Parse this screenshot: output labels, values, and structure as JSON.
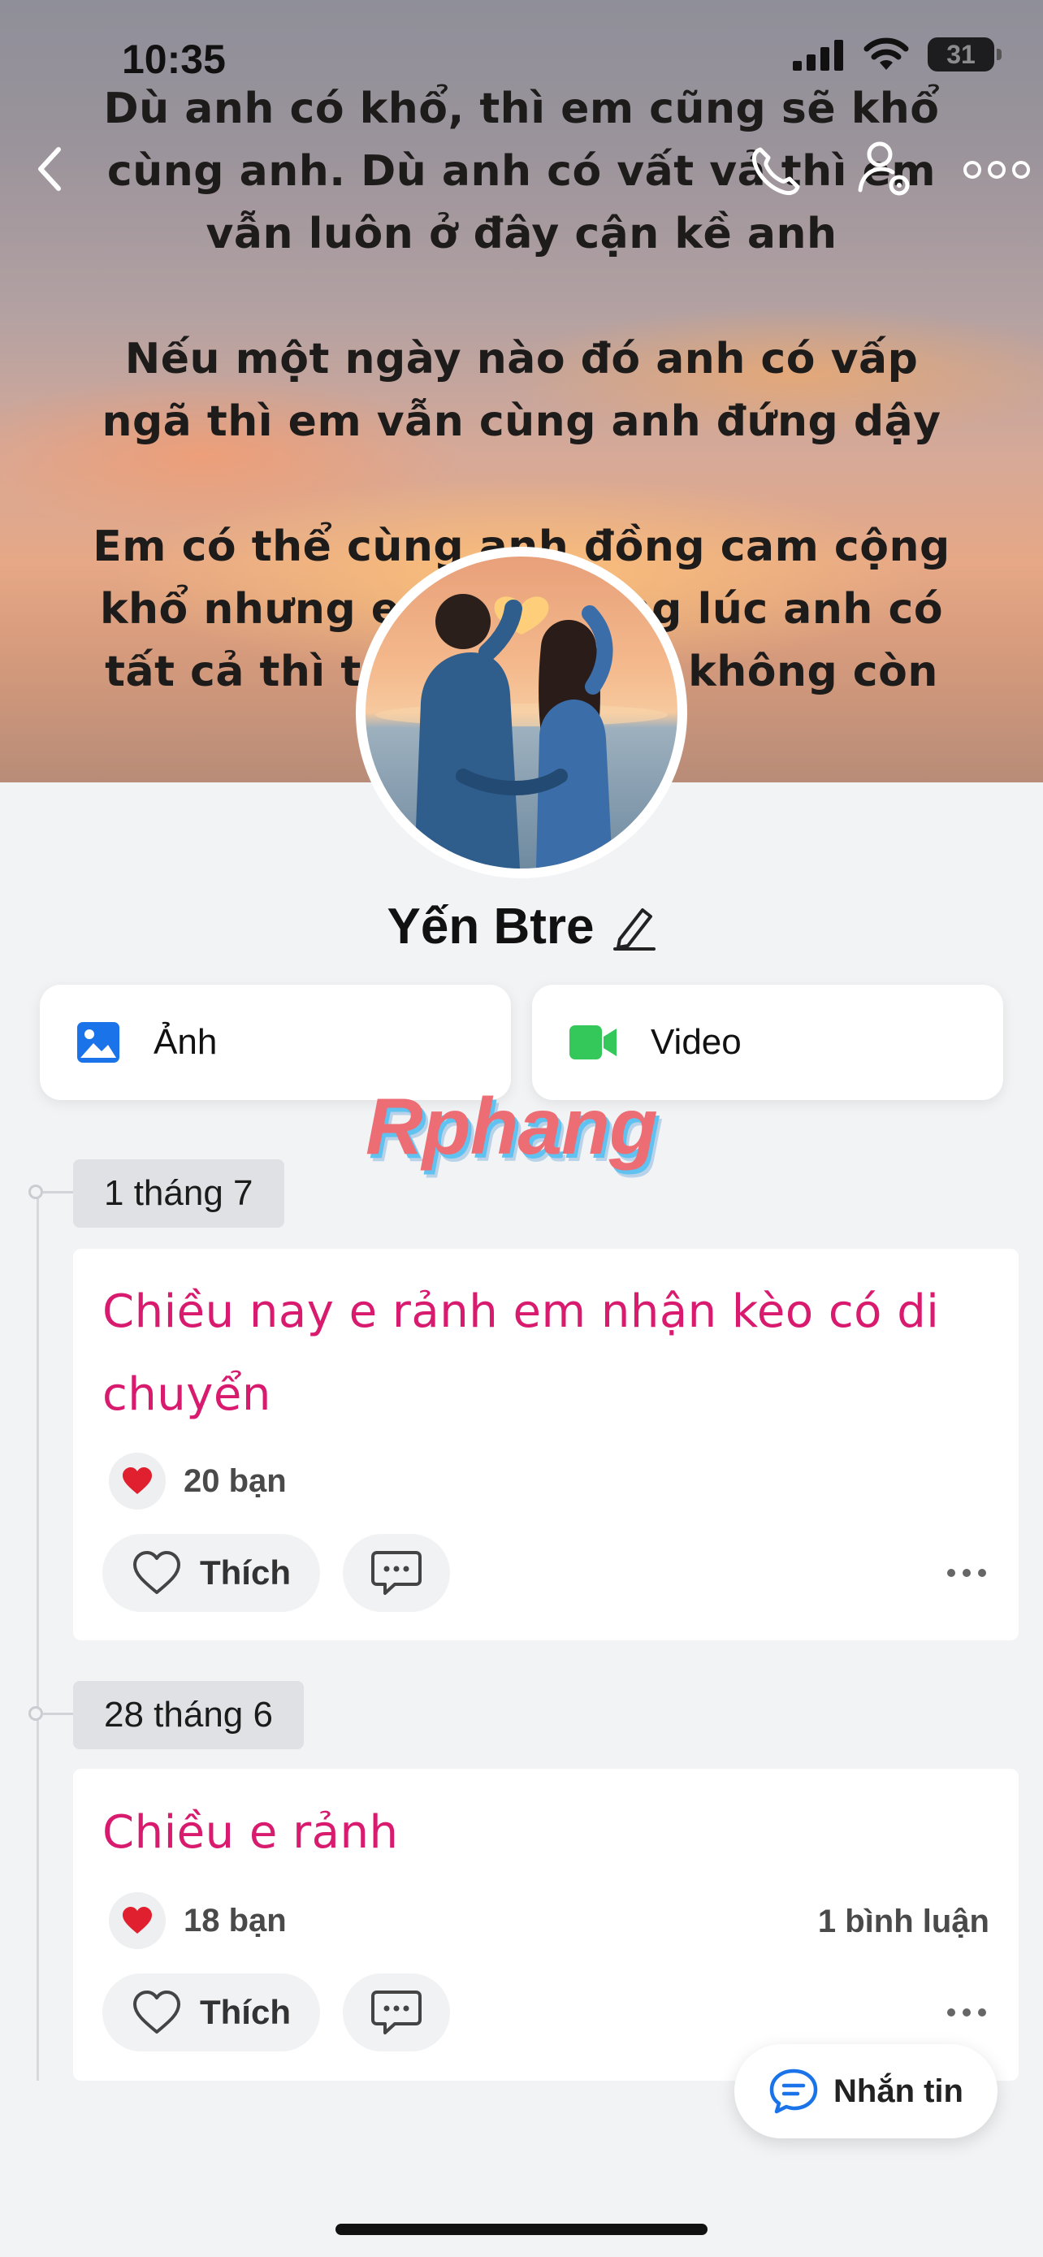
{
  "status_bar": {
    "time": "10:35",
    "battery": "31"
  },
  "cover": {
    "quote": "Dù anh có khổ, thì em cũng sẽ khổ\ncùng anh. Dù anh có vất vả thì em\nvẫn luôn ở đây cận kề anh\n\nNếu một ngày nào đó anh có vấp\nngã thì em vẫn cùng anh đứng dậy\n\nEm có thể cùng anh đồng cam cộng\nkhổ nhưng em sợ những lúc anh có\ntất cả thì trong tim anh không còn"
  },
  "nav": {
    "back_icon": "chevron-left-icon",
    "call_icon": "phone-icon",
    "settings_icon": "user-settings-icon",
    "more_icon": "more-horizontal-icon"
  },
  "profile": {
    "name": "Yến Btre",
    "edit_icon": "pencil-icon"
  },
  "media": {
    "photos_label": "Ảnh",
    "videos_label": "Video",
    "photo_color": "#1a73e8",
    "video_color": "#34c759"
  },
  "watermark": "Rphang",
  "posts": [
    {
      "date": "1 tháng 7",
      "text_line1": "Chiều nay e rảnh em nhận kèo có di",
      "text_line2": "chuyển",
      "reactions": "20 bạn",
      "comments": "",
      "like_label": "Thích"
    },
    {
      "date": "28 tháng 6",
      "text_line1": "Chiều e rảnh",
      "text_line2": "",
      "reactions": "18 bạn",
      "comments": "1 bình luận",
      "like_label": "Thích"
    }
  ],
  "chat_fab": {
    "label": "Nhắn tin"
  },
  "colors": {
    "post_text": "#d81b6e",
    "heart": "#e0202e",
    "chat_icon": "#1a73e8"
  }
}
